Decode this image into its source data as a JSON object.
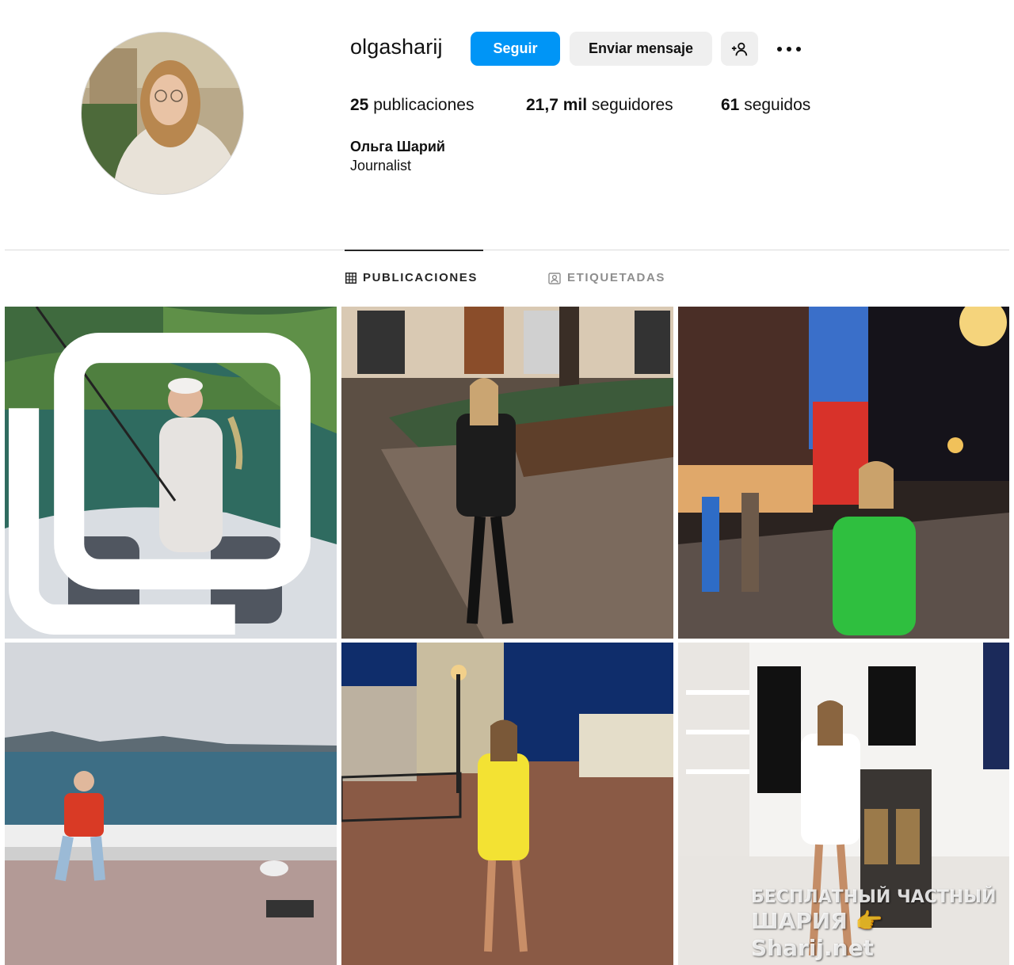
{
  "profile": {
    "username": "olgasharij",
    "full_name": "Ольга Шарий",
    "bio": "Journalist"
  },
  "actions": {
    "follow_label": "Seguir",
    "message_label": "Enviar mensaje",
    "suggest_icon": "add-person-icon",
    "more_icon": "more-horizontal-icon"
  },
  "stats": {
    "posts_count": "25",
    "posts_label": "publicaciones",
    "followers_count": "21,7 mil",
    "followers_label": "seguidores",
    "following_count": "61",
    "following_label": "seguidos"
  },
  "tabs": [
    {
      "label": "PUBLICACIONES",
      "icon": "grid-icon",
      "active": true
    },
    {
      "label": "ETIQUETADAS",
      "icon": "tagged-icon",
      "active": false
    }
  ],
  "posts": [
    {
      "scene": "woman fishing on boat at lake",
      "multi": true
    },
    {
      "scene": "woman in black sitting on bench at night",
      "multi": false
    },
    {
      "scene": "woman in green vest on lit street at night",
      "multi": false
    },
    {
      "scene": "woman in red vest sitting by the sea with seagull",
      "multi": false
    },
    {
      "scene": "woman in yellow dress in plaza at night",
      "multi": false
    },
    {
      "scene": "woman in white dress in dining room",
      "multi": false
    }
  ],
  "watermark": {
    "line1": "БЕСПЛАТНЫЙ ЧАСТНЫЙ",
    "line2": "ШАРИЯ 👉 Sharij.net"
  },
  "colors": {
    "accent": "#0095f6",
    "secondary_button": "#efefef",
    "divider": "#dbdbdb",
    "muted_text": "#8e8e8e"
  }
}
